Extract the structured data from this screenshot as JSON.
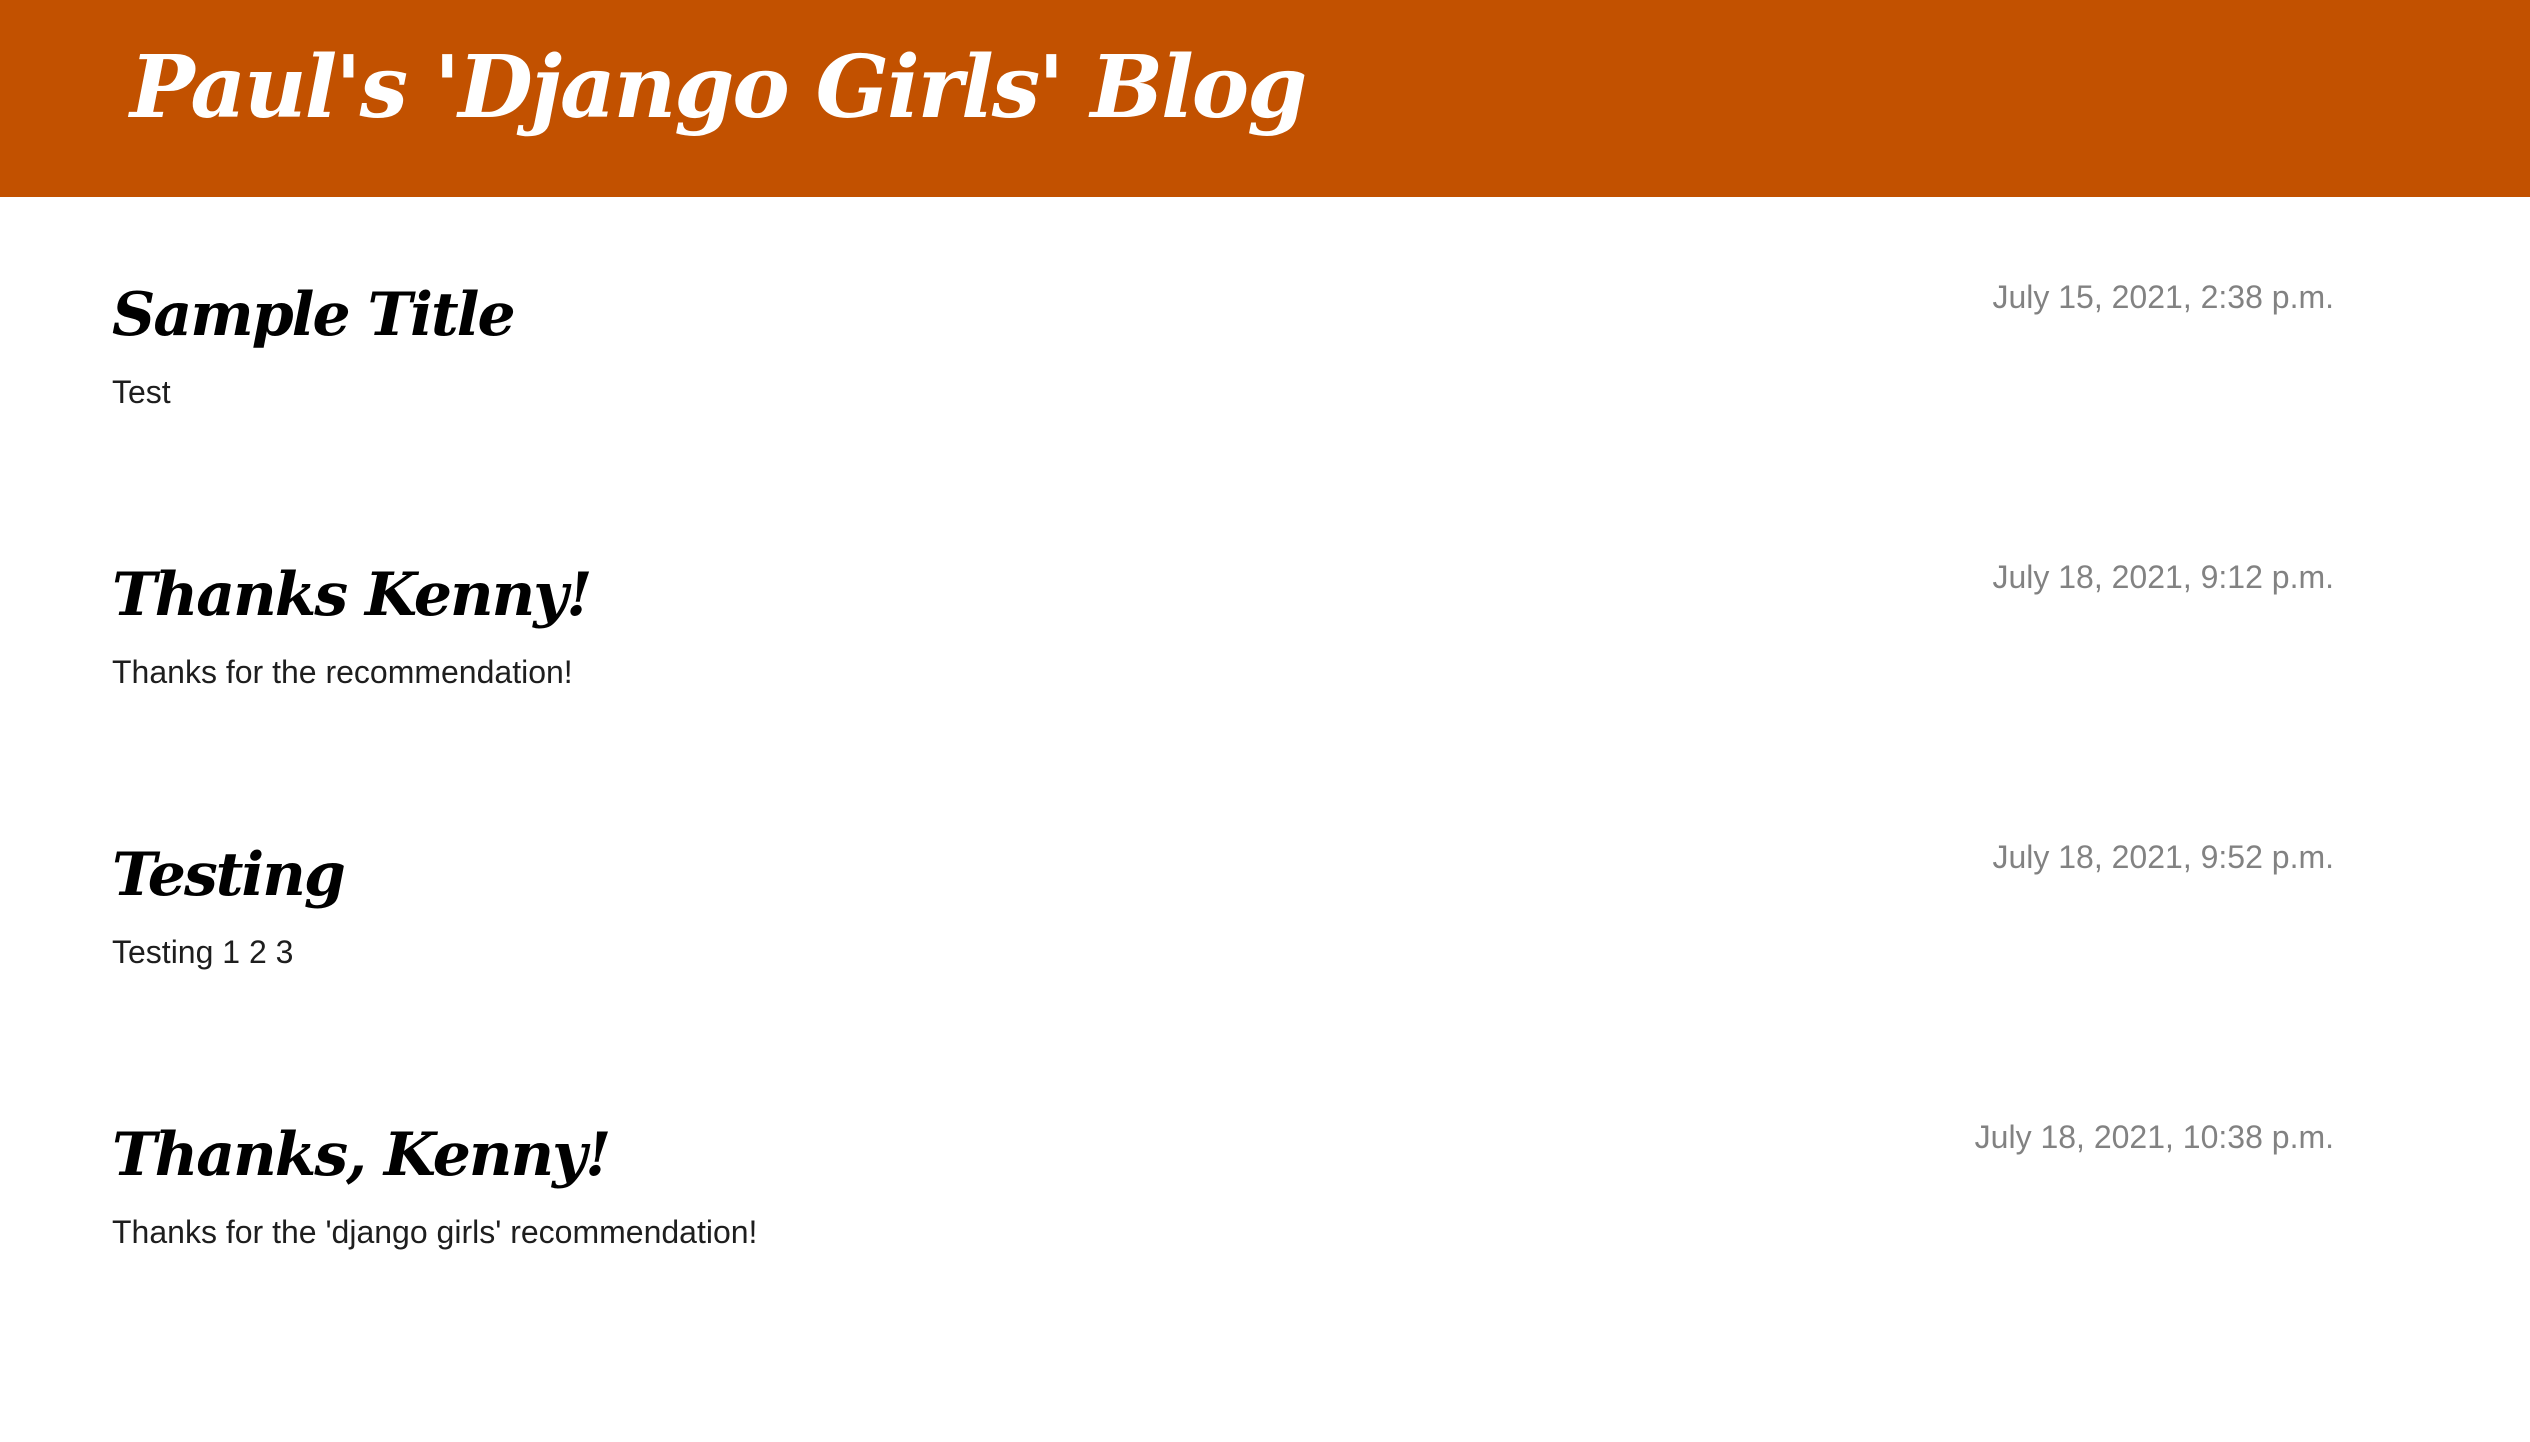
{
  "header": {
    "title": "Paul's 'Django Girls' Blog",
    "background_color": "#c25100"
  },
  "posts": [
    {
      "date": "July 15, 2021, 2:38 p.m.",
      "title": "Sample Title",
      "text": "Test"
    },
    {
      "date": "July 18, 2021, 9:12 p.m.",
      "title": "Thanks Kenny!",
      "text": "Thanks for the recommendation!"
    },
    {
      "date": "July 18, 2021, 9:52 p.m.",
      "title": "Testing",
      "text": "Testing 1 2 3"
    },
    {
      "date": "July 18, 2021, 10:38 p.m.",
      "title": "Thanks, Kenny!",
      "text": "Thanks for the 'django girls' recommendation!"
    }
  ]
}
